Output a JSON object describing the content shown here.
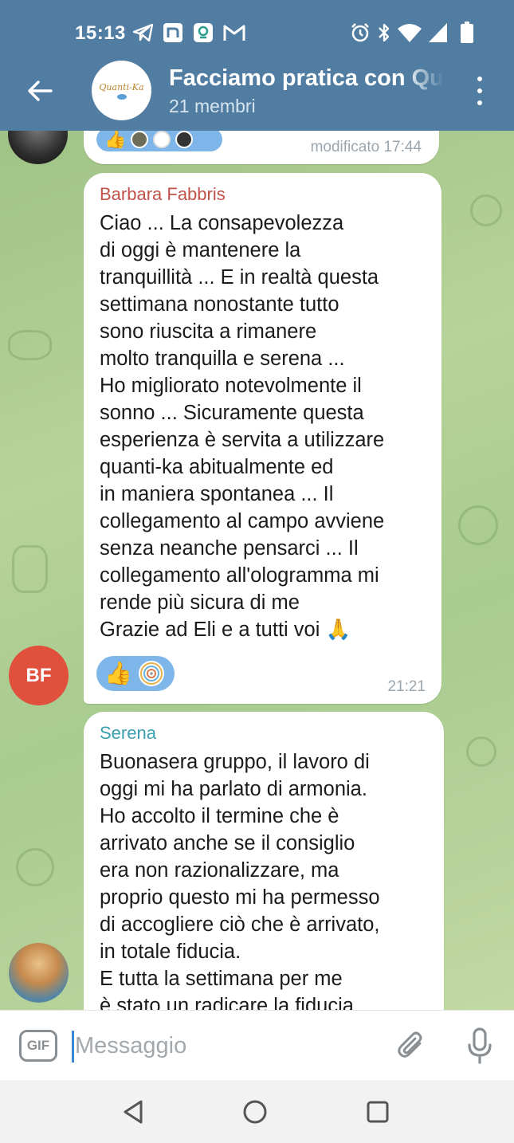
{
  "status_bar": {
    "time": "15:13",
    "left_icons": [
      "telegram-icon",
      "notion-icon",
      "maps-icon",
      "gmail-icon"
    ],
    "right_icons": [
      "alarm-icon",
      "bluetooth-icon",
      "wifi-icon",
      "signal-icon",
      "battery-icon"
    ]
  },
  "header": {
    "title": "Facciamo pratica con Quanti-Ka",
    "subtitle": "21 membri",
    "avatar_logo": "Quanti-Ka",
    "back_icon": "arrow-left-icon",
    "menu_icon": "more-vert-icon"
  },
  "colors": {
    "header": "#517da2",
    "sender_barbara": "#c0524a",
    "sender_serena": "#3a9fb0",
    "reaction_pill": "#7eb6ea",
    "avatar_bf": "#e0503d"
  },
  "messages": [
    {
      "edited_time": "modificato 17:44"
    },
    {
      "sender": "Barbara Fabbris",
      "avatar_initials": "BF",
      "text": "Ciao ... La consapevolezza\ndi oggi è mantenere la\ntranquillità ... E in realtà questa\nsettimana nonostante tutto\nsono riuscita a rimanere\nmolto tranquilla e serena ...\nHo migliorato notevolmente il\nsonno ... Sicuramente questa\nesperienza è servita a utilizzare\nquanti-ka  abitualmente ed\nin maniera spontanea ... Il\ncollegamento al campo avviene\nsenza neanche pensarci ... Il\ncollegamento all'ologramma mi\nrende più sicura di me\nGrazie ad Eli e a tutti voi 🙏",
      "time": "21:21",
      "reactions": [
        "👍",
        "spiral-icon"
      ]
    },
    {
      "sender": "Serena",
      "text": "Buonasera gruppo, il lavoro di\noggi mi ha parlato di armonia.\nHo accolto il termine che è\narrivato anche se il consiglio\nera non razionalizzare, ma\nproprio questo mi ha permesso\ndi accogliere ciò che è arrivato,\nin totale fiducia.\nE tutta la settimana per me\nè stato un radicare la fiducia"
    }
  ],
  "input": {
    "gif_label": "GIF",
    "placeholder": "Messaggio"
  },
  "nav": {
    "icons": [
      "back-triangle-icon",
      "home-circle-icon",
      "recents-square-icon"
    ]
  }
}
